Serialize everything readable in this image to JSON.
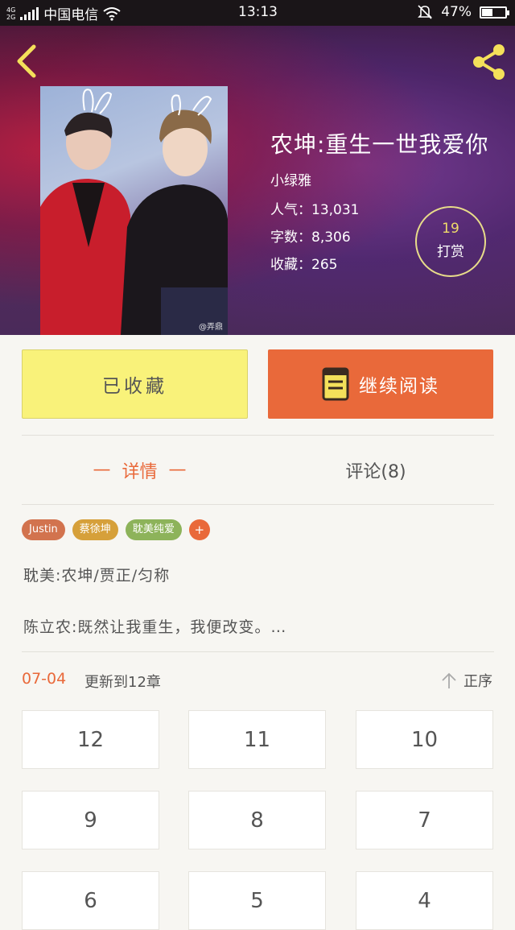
{
  "status_bar": {
    "network_top": "4G",
    "network_bottom": "2G",
    "carrier": "中国电信",
    "time": "13:13",
    "battery": "47%",
    "battery_level": 0.47
  },
  "header": {
    "back_icon": "chevron-left-icon",
    "share_icon": "share-icon"
  },
  "book": {
    "title": "农坤:重生一世我爱你",
    "author": "小绿雅",
    "popularity_label": "人气：",
    "popularity": "13,031",
    "words_label": "字数：",
    "words": "8,306",
    "favorites_label": "收藏：",
    "favorites": "265",
    "cover_watermark": "@弄鼎",
    "tip_count": "19",
    "tip_label": "打赏"
  },
  "actions": {
    "collected_label": "已收藏",
    "continue_label": "继续阅读",
    "continue_icon": "book-icon"
  },
  "tabs": {
    "details": "详情",
    "comments": "评论(8)"
  },
  "tags": [
    {
      "label": "Justin",
      "color": "#d2734e"
    },
    {
      "label": "蔡徐坤",
      "color": "#d6a03a"
    },
    {
      "label": "耽美纯爱",
      "color": "#8db35a"
    }
  ],
  "tag_add_label": "+",
  "description": {
    "line1": "耽美:农坤/贾正/匀称",
    "line2": "陈立农:既然让我重生，我便改变。…"
  },
  "update": {
    "date": "07-04",
    "text": "更新到12章",
    "sort_label": "正序"
  },
  "chapters": [
    "12",
    "11",
    "10",
    "9",
    "8",
    "7",
    "6",
    "5",
    "4"
  ],
  "colors": {
    "accent": "#e9693a",
    "collected_bg": "#f9f27a",
    "icon_yellow": "#f4e05a"
  }
}
